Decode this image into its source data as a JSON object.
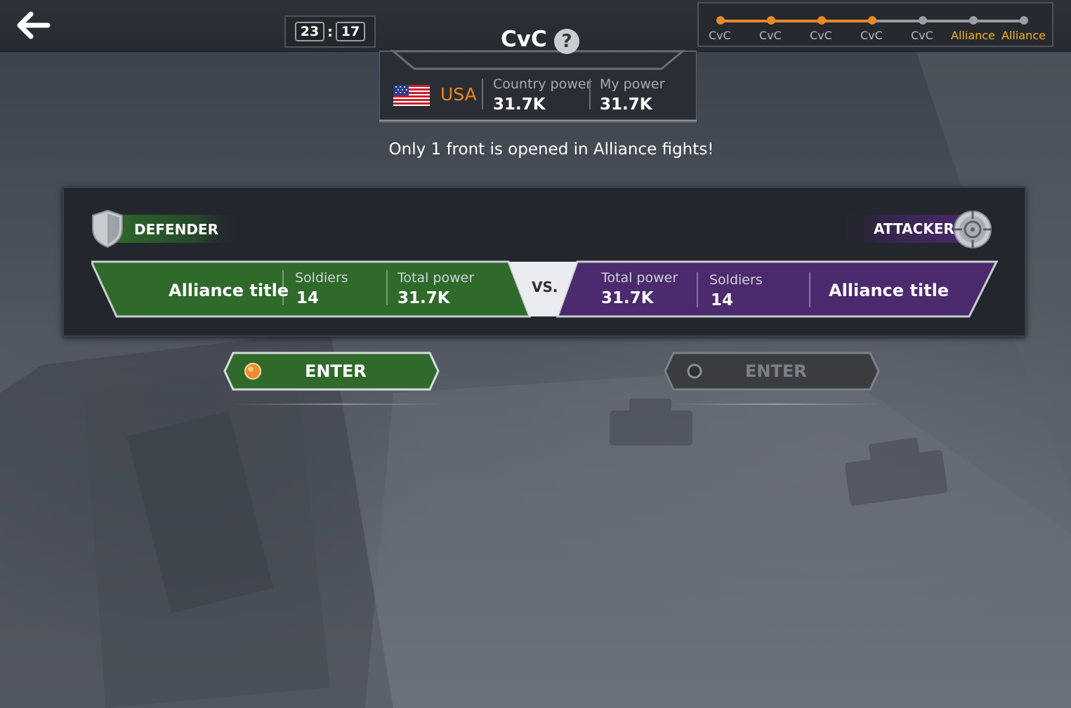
{
  "timer": {
    "minutes": "23",
    "seconds": "17",
    "separator": ":"
  },
  "header": {
    "title": "CvC",
    "help": "?"
  },
  "country": {
    "name": "USA",
    "country_power_label": "Country power",
    "country_power_value": "31.7K",
    "my_power_label": "My power",
    "my_power_value": "31.7K"
  },
  "schedule": {
    "stages": [
      {
        "label": "CvC",
        "state": "done"
      },
      {
        "label": "CvC",
        "state": "done"
      },
      {
        "label": "CvC",
        "state": "done"
      },
      {
        "label": "CvC",
        "state": "current"
      },
      {
        "label": "CvC",
        "state": "upcoming"
      },
      {
        "label": "Alliance",
        "state": "upcoming"
      },
      {
        "label": "Alliance",
        "state": "upcoming"
      }
    ],
    "colors": {
      "done": "#e8892a",
      "upcoming": "#9a9ea4",
      "alliance_text": "#f4b41e"
    }
  },
  "notice": "Only 1 front is opened in Alliance fights!",
  "defender": {
    "tag": "DEFENDER",
    "title": "Alliance title",
    "soldiers_label": "Soldiers",
    "soldiers_value": "14",
    "power_label": "Total power",
    "power_value": "31.7K",
    "color": "#2f6a2b"
  },
  "attacker": {
    "tag": "ATTACKER",
    "title": "Alliance title",
    "soldiers_label": "Soldiers",
    "soldiers_value": "14",
    "power_label": "Total power",
    "power_value": "31.7K",
    "color": "#4b2a6e"
  },
  "vs": "VS.",
  "buttons": {
    "defender_enter": {
      "label": "ENTER",
      "enabled": true
    },
    "attacker_enter": {
      "label": "ENTER",
      "enabled": false
    }
  },
  "icons": {
    "back": "arrow-left-icon",
    "help": "question-icon",
    "flag": "usa-flag-icon",
    "defender": "shield-icon",
    "attacker": "crosshair-icon"
  }
}
